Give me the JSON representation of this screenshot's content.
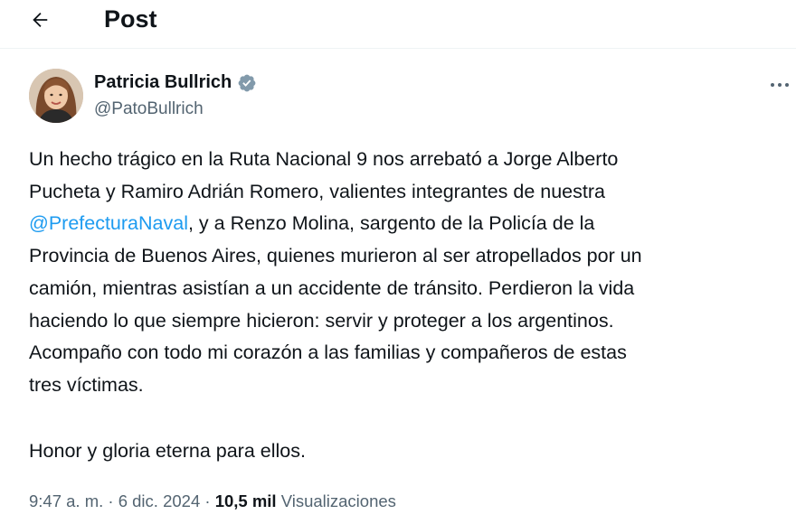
{
  "header": {
    "title": "Post"
  },
  "author": {
    "name": "Patricia Bullrich",
    "handle": "@PatoBullrich"
  },
  "post": {
    "line1": "Un hecho trágico en la Ruta Nacional 9 nos arrebató a Jorge Alberto",
    "line2": "Pucheta y Ramiro Adrián Romero, valientes integrantes de nuestra",
    "line3_mention": "@PrefecturaNaval",
    "line3_rest": ", y a Renzo Molina, sargento de la Policía de la",
    "line4": "Provincia de Buenos Aires, quienes murieron al ser atropellados por un",
    "line5": "camión, mientras asistían a un accidente de tránsito. Perdieron la vida",
    "line6": "haciendo lo que siempre hicieron: servir y proteger a los argentinos.",
    "line7": "Acompaño con todo mi corazón a las familias y compañeros de estas",
    "line8": "tres víctimas.",
    "closing": "Honor y gloria eterna para ellos."
  },
  "meta": {
    "time": "9:47 a. m.",
    "sep1": " · ",
    "date": "6 dic. 2024",
    "sep2": " · ",
    "views_count": "10,5 mil",
    "views_label": "Visualizaciones"
  },
  "colors": {
    "link": "#1d9bf0",
    "secondary_text": "#536471",
    "primary_text": "#0f1419"
  },
  "icons": {
    "back": "arrow-left-icon",
    "verified": "verified-badge-icon",
    "more": "more-horizontal-icon"
  }
}
